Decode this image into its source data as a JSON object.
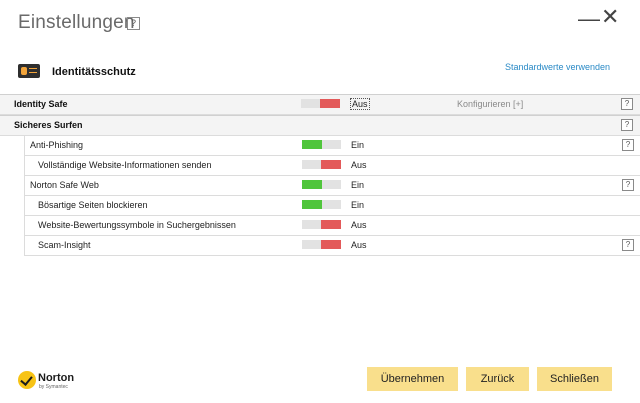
{
  "window": {
    "title": "Einstellungen",
    "help": "?",
    "minimize_icon": "—",
    "close_icon": "✕"
  },
  "header": {
    "section_title": "Identitätsschutz",
    "defaults_link": "Standardwerte verwenden",
    "icon": "id-card-icon"
  },
  "rows": {
    "identity_safe": {
      "label": "Identity Safe",
      "status": "Aus",
      "state": "off",
      "config": "Konfigurieren [+]",
      "help": "?"
    },
    "sicheres_surfen": {
      "label": "Sicheres Surfen",
      "help": "?"
    },
    "anti_phishing": {
      "label": "Anti-Phishing",
      "status": "Ein",
      "state": "on",
      "help": "?"
    },
    "website_info": {
      "label": "Vollständige Website-Informationen senden",
      "status": "Aus",
      "state": "off"
    },
    "safe_web": {
      "label": "Norton Safe Web",
      "status": "Ein",
      "state": "on",
      "help": "?"
    },
    "block_pages": {
      "label": "Bösartige Seiten blockieren",
      "status": "Ein",
      "state": "on"
    },
    "rating_icons": {
      "label": "Website-Bewertungssymbole in Suchergebnissen",
      "status": "Aus",
      "state": "off"
    },
    "scam_insight": {
      "label": "Scam-Insight",
      "status": "Aus",
      "state": "off",
      "help": "?"
    }
  },
  "footer": {
    "logo_text": "Norton",
    "logo_sub": "by Symantec",
    "apply": "Übernehmen",
    "back": "Zurück",
    "close": "Schließen"
  },
  "colors": {
    "on": "#4fc53b",
    "off": "#e35a5a",
    "button": "#f9df8c",
    "link": "#2a8ac6"
  }
}
